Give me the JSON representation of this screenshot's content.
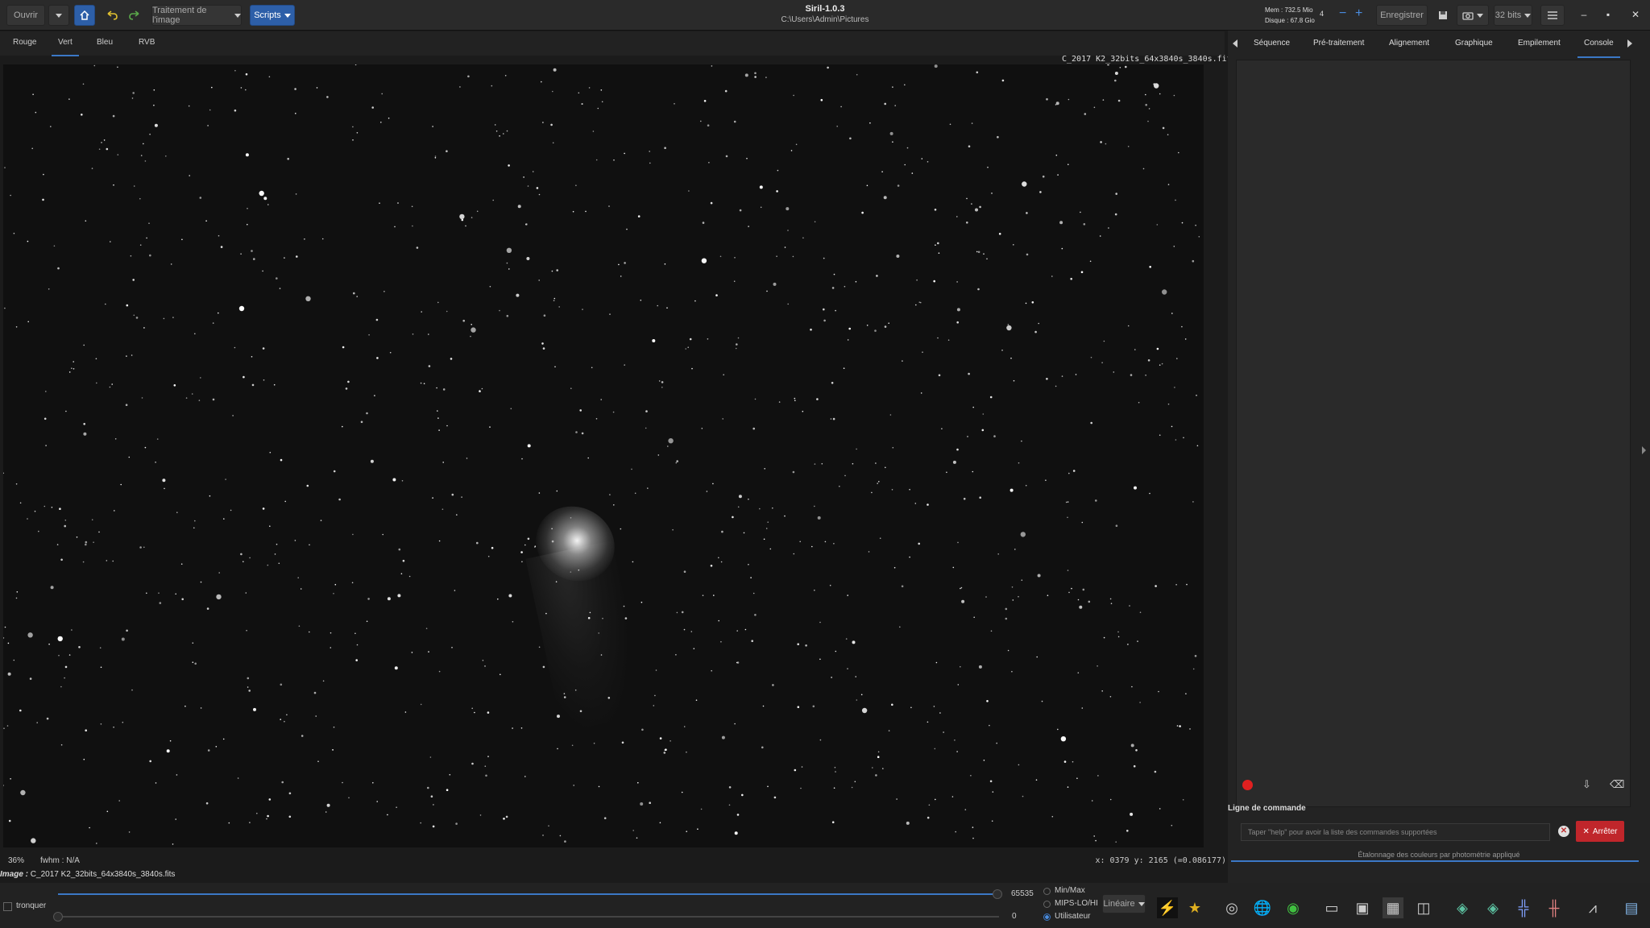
{
  "header": {
    "open_label": "Ouvrir",
    "processing_label": "Traitement de l'image",
    "scripts_label": "Scripts",
    "app_title": "Siril-1.0.3",
    "working_dir": "C:\\Users\\Admin\\Pictures",
    "mem": "Mem : 732.5 Mio",
    "disk": "Disque : 67.8 Gio",
    "thread_count": "4",
    "save_label": "Enregistrer",
    "bit_depth": "32 bits"
  },
  "channel_tabs": [
    "Rouge",
    "Vert",
    "Bleu",
    "RVB"
  ],
  "active_channel": "Vert",
  "image": {
    "filename": "C_2017 K2_32bits_64x3840s_3840s.fits",
    "zoom": "36%",
    "fwhm": "fwhm : N/A",
    "coords": "x: 0379  y: 2165 (=0.086177)",
    "image_label_prefix": "Image :",
    "image_label_name": "C_2017 K2_32bits_64x3840s_3840s.fits"
  },
  "bottom": {
    "clip_label": "tronquer",
    "hi_value": "65535",
    "lo_value": "0",
    "radio_options": [
      "Min/Max",
      "MIPS-LO/HI",
      "Utilisateur"
    ],
    "selected_radio": "Utilisateur",
    "stretch_mode": "Linéaire"
  },
  "right_panel": {
    "tabs": [
      "Séquence",
      "Pré-traitement",
      "Alignement",
      "Graphique",
      "Empilement",
      "Console"
    ],
    "active_tab": "Console",
    "cmd_line_label": "Ligne de commande",
    "cmd_placeholder": "Taper \"help\" pour avoir la liste des commandes supportées",
    "stop_label": "Arrêter",
    "status_message": "Étalonnage des couleurs par photométrie appliqué"
  },
  "colors": {
    "accent": "#3b78c6",
    "stop_red": "#c0262b",
    "panel_bg": "#232323"
  }
}
